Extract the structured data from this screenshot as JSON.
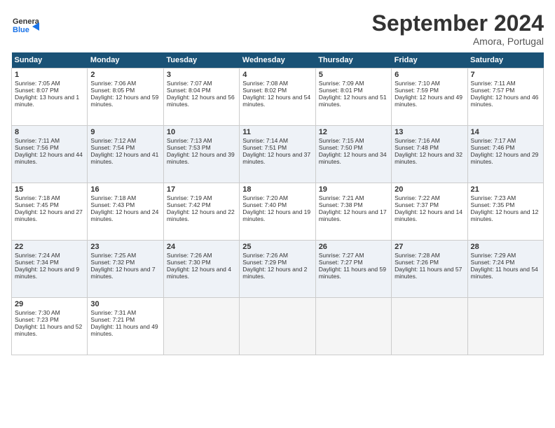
{
  "header": {
    "logo_line1": "General",
    "logo_line2": "Blue",
    "title": "September 2024",
    "location": "Amora, Portugal"
  },
  "days_of_week": [
    "Sunday",
    "Monday",
    "Tuesday",
    "Wednesday",
    "Thursday",
    "Friday",
    "Saturday"
  ],
  "weeks": [
    [
      {
        "num": "1",
        "sunrise": "Sunrise: 7:05 AM",
        "sunset": "Sunset: 8:07 PM",
        "daylight": "Daylight: 13 hours and 1 minute."
      },
      {
        "num": "2",
        "sunrise": "Sunrise: 7:06 AM",
        "sunset": "Sunset: 8:05 PM",
        "daylight": "Daylight: 12 hours and 59 minutes."
      },
      {
        "num": "3",
        "sunrise": "Sunrise: 7:07 AM",
        "sunset": "Sunset: 8:04 PM",
        "daylight": "Daylight: 12 hours and 56 minutes."
      },
      {
        "num": "4",
        "sunrise": "Sunrise: 7:08 AM",
        "sunset": "Sunset: 8:02 PM",
        "daylight": "Daylight: 12 hours and 54 minutes."
      },
      {
        "num": "5",
        "sunrise": "Sunrise: 7:09 AM",
        "sunset": "Sunset: 8:01 PM",
        "daylight": "Daylight: 12 hours and 51 minutes."
      },
      {
        "num": "6",
        "sunrise": "Sunrise: 7:10 AM",
        "sunset": "Sunset: 7:59 PM",
        "daylight": "Daylight: 12 hours and 49 minutes."
      },
      {
        "num": "7",
        "sunrise": "Sunrise: 7:11 AM",
        "sunset": "Sunset: 7:57 PM",
        "daylight": "Daylight: 12 hours and 46 minutes."
      }
    ],
    [
      {
        "num": "8",
        "sunrise": "Sunrise: 7:11 AM",
        "sunset": "Sunset: 7:56 PM",
        "daylight": "Daylight: 12 hours and 44 minutes."
      },
      {
        "num": "9",
        "sunrise": "Sunrise: 7:12 AM",
        "sunset": "Sunset: 7:54 PM",
        "daylight": "Daylight: 12 hours and 41 minutes."
      },
      {
        "num": "10",
        "sunrise": "Sunrise: 7:13 AM",
        "sunset": "Sunset: 7:53 PM",
        "daylight": "Daylight: 12 hours and 39 minutes."
      },
      {
        "num": "11",
        "sunrise": "Sunrise: 7:14 AM",
        "sunset": "Sunset: 7:51 PM",
        "daylight": "Daylight: 12 hours and 37 minutes."
      },
      {
        "num": "12",
        "sunrise": "Sunrise: 7:15 AM",
        "sunset": "Sunset: 7:50 PM",
        "daylight": "Daylight: 12 hours and 34 minutes."
      },
      {
        "num": "13",
        "sunrise": "Sunrise: 7:16 AM",
        "sunset": "Sunset: 7:48 PM",
        "daylight": "Daylight: 12 hours and 32 minutes."
      },
      {
        "num": "14",
        "sunrise": "Sunrise: 7:17 AM",
        "sunset": "Sunset: 7:46 PM",
        "daylight": "Daylight: 12 hours and 29 minutes."
      }
    ],
    [
      {
        "num": "15",
        "sunrise": "Sunrise: 7:18 AM",
        "sunset": "Sunset: 7:45 PM",
        "daylight": "Daylight: 12 hours and 27 minutes."
      },
      {
        "num": "16",
        "sunrise": "Sunrise: 7:18 AM",
        "sunset": "Sunset: 7:43 PM",
        "daylight": "Daylight: 12 hours and 24 minutes."
      },
      {
        "num": "17",
        "sunrise": "Sunrise: 7:19 AM",
        "sunset": "Sunset: 7:42 PM",
        "daylight": "Daylight: 12 hours and 22 minutes."
      },
      {
        "num": "18",
        "sunrise": "Sunrise: 7:20 AM",
        "sunset": "Sunset: 7:40 PM",
        "daylight": "Daylight: 12 hours and 19 minutes."
      },
      {
        "num": "19",
        "sunrise": "Sunrise: 7:21 AM",
        "sunset": "Sunset: 7:38 PM",
        "daylight": "Daylight: 12 hours and 17 minutes."
      },
      {
        "num": "20",
        "sunrise": "Sunrise: 7:22 AM",
        "sunset": "Sunset: 7:37 PM",
        "daylight": "Daylight: 12 hours and 14 minutes."
      },
      {
        "num": "21",
        "sunrise": "Sunrise: 7:23 AM",
        "sunset": "Sunset: 7:35 PM",
        "daylight": "Daylight: 12 hours and 12 minutes."
      }
    ],
    [
      {
        "num": "22",
        "sunrise": "Sunrise: 7:24 AM",
        "sunset": "Sunset: 7:34 PM",
        "daylight": "Daylight: 12 hours and 9 minutes."
      },
      {
        "num": "23",
        "sunrise": "Sunrise: 7:25 AM",
        "sunset": "Sunset: 7:32 PM",
        "daylight": "Daylight: 12 hours and 7 minutes."
      },
      {
        "num": "24",
        "sunrise": "Sunrise: 7:26 AM",
        "sunset": "Sunset: 7:30 PM",
        "daylight": "Daylight: 12 hours and 4 minutes."
      },
      {
        "num": "25",
        "sunrise": "Sunrise: 7:26 AM",
        "sunset": "Sunset: 7:29 PM",
        "daylight": "Daylight: 12 hours and 2 minutes."
      },
      {
        "num": "26",
        "sunrise": "Sunrise: 7:27 AM",
        "sunset": "Sunset: 7:27 PM",
        "daylight": "Daylight: 11 hours and 59 minutes."
      },
      {
        "num": "27",
        "sunrise": "Sunrise: 7:28 AM",
        "sunset": "Sunset: 7:26 PM",
        "daylight": "Daylight: 11 hours and 57 minutes."
      },
      {
        "num": "28",
        "sunrise": "Sunrise: 7:29 AM",
        "sunset": "Sunset: 7:24 PM",
        "daylight": "Daylight: 11 hours and 54 minutes."
      }
    ],
    [
      {
        "num": "29",
        "sunrise": "Sunrise: 7:30 AM",
        "sunset": "Sunset: 7:23 PM",
        "daylight": "Daylight: 11 hours and 52 minutes."
      },
      {
        "num": "30",
        "sunrise": "Sunrise: 7:31 AM",
        "sunset": "Sunset: 7:21 PM",
        "daylight": "Daylight: 11 hours and 49 minutes."
      },
      null,
      null,
      null,
      null,
      null
    ]
  ]
}
